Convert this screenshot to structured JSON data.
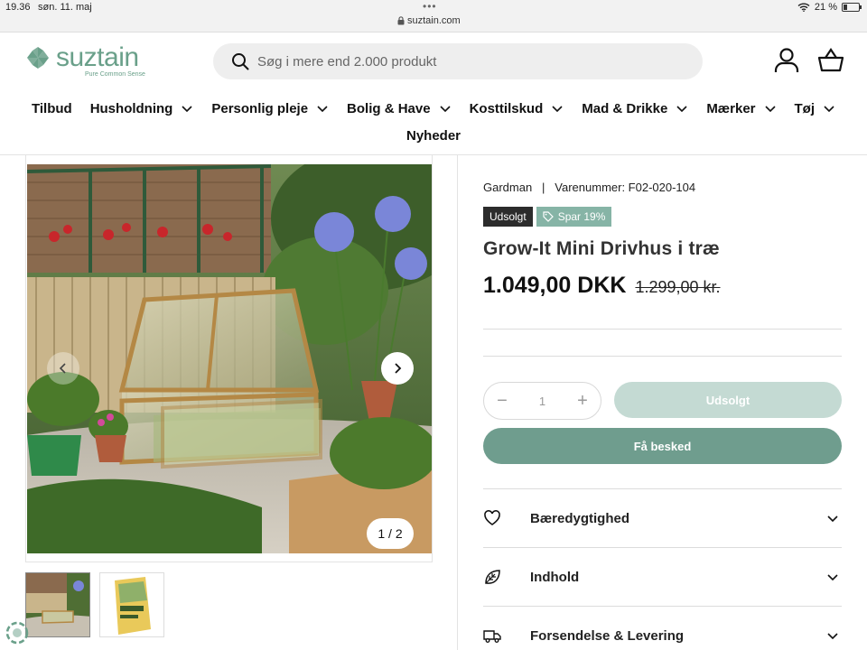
{
  "status_bar": {
    "time": "19.36",
    "date": "søn. 11. maj",
    "url": "suztain.com",
    "battery": "21 %"
  },
  "header": {
    "logo_name": "suztain",
    "logo_tagline": "Pure Common Sense",
    "search_placeholder": "Søg i mere end 2.000 produkt"
  },
  "nav": {
    "items": [
      {
        "label": "Tilbud",
        "dropdown": false
      },
      {
        "label": "Husholdning",
        "dropdown": true
      },
      {
        "label": "Personlig pleje",
        "dropdown": true
      },
      {
        "label": "Bolig & Have",
        "dropdown": true
      },
      {
        "label": "Kosttilskud",
        "dropdown": true
      },
      {
        "label": "Mad & Drikke",
        "dropdown": true
      },
      {
        "label": "Mærker",
        "dropdown": true
      },
      {
        "label": "Tøj",
        "dropdown": true
      }
    ],
    "second_row": "Nyheder"
  },
  "gallery": {
    "counter": "1 / 2",
    "thumb_count": 2
  },
  "product": {
    "brand": "Gardman",
    "sku_label": "Varenummer: F02-020-104",
    "badge_sold": "Udsolgt",
    "badge_save": "Spar 19%",
    "title": "Grow-It Mini Drivhus i træ",
    "price": "1.049,00 DKK",
    "price_old": "1.299,00 kr.",
    "quantity": "1",
    "btn_soldout": "Udsolgt",
    "btn_notify": "Få besked"
  },
  "accordion": [
    {
      "label": "Bæredygtighed",
      "icon": "heart-icon"
    },
    {
      "label": "Indhold",
      "icon": "leaf-icon"
    },
    {
      "label": "Forsendelse & Levering",
      "icon": "truck-icon"
    }
  ],
  "colors": {
    "brand": "#6aa08a",
    "notify_button": "#6f9d8e",
    "soldout_button": "#c4dad3",
    "save_badge": "#86b4a6"
  }
}
